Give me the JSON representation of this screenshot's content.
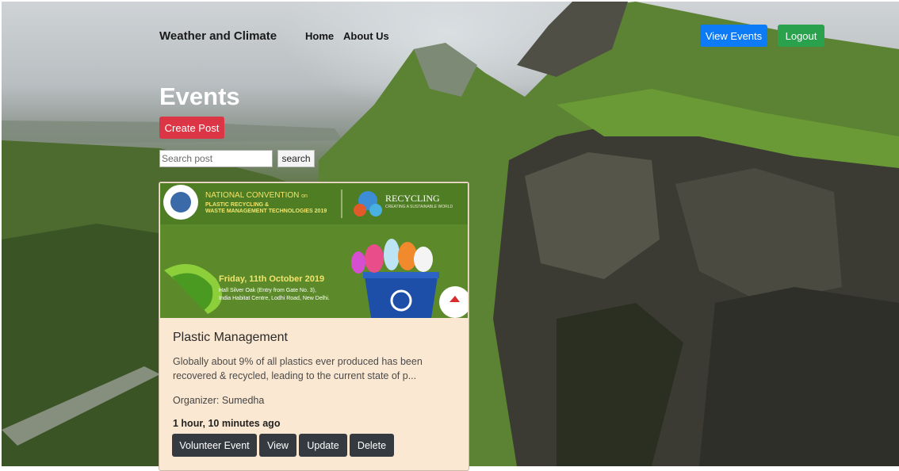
{
  "navbar": {
    "brand": "Weather and Climate",
    "links": [
      "Home",
      "About Us"
    ],
    "view_events_label": "View Events",
    "logout_label": "Logout"
  },
  "page": {
    "title": "Events",
    "create_post_label": "Create Post"
  },
  "search": {
    "placeholder": "Search post",
    "value": "",
    "button_label": "search"
  },
  "events": [
    {
      "banner": {
        "heading_line1": "NATIONAL CONVENTION",
        "heading_on": "on",
        "heading_line2": "PLASTIC RECYCLING &",
        "heading_line3": "WASTE MANAGEMENT TECHNOLOGIES 2019",
        "brand": "RECYCLING",
        "brand_tagline": "CREATING A SUSTAINABLE WORLD",
        "date": "Friday, 11th October 2019",
        "venue_line1": "Hall Silver Oak (Entry from Gate No. 3),",
        "venue_line2": "India Habitat Centre, Lodhi Road, New Delhi."
      },
      "title": "Plastic Management",
      "description": "Globally about 9% of all plastics ever produced has been recovered & recycled, leading to the current state of p...",
      "organizer": "Organizer: Sumedha",
      "time_ago": "1 hour, 10 minutes ago",
      "actions": {
        "volunteer": "Volunteer Event",
        "view": "View",
        "update": "Update",
        "delete": "Delete"
      }
    }
  ],
  "colors": {
    "primary": "#0d7bf5",
    "success": "#2aa14d",
    "danger": "#dc3545",
    "dark": "#343a40",
    "card_bg": "#fbe8d2"
  }
}
